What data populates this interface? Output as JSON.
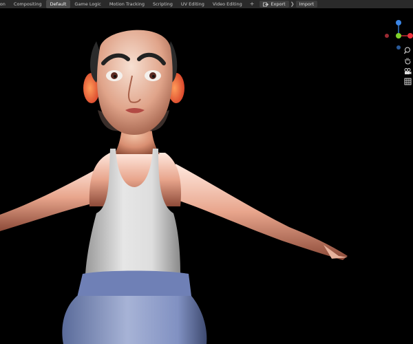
{
  "workspace_tabs": [
    {
      "label": "ion",
      "active": false
    },
    {
      "label": "Compositing",
      "active": false
    },
    {
      "label": "Default",
      "active": true
    },
    {
      "label": "Game Logic",
      "active": false
    },
    {
      "label": "Motion Tracking",
      "active": false
    },
    {
      "label": "Scripting",
      "active": false
    },
    {
      "label": "UV Editing",
      "active": false
    },
    {
      "label": "Video Editing",
      "active": false
    }
  ],
  "add_workspace_label": "+",
  "addons": {
    "export_label": "Export",
    "import_label": "Import",
    "export_icon": "export-icon"
  },
  "gizmo": {
    "x_color": "#e8333e",
    "y_color": "#7fd12a",
    "z_color": "#3b86e6",
    "neg_x_color": "#9b2a33",
    "neg_y_color": "#4d7a22",
    "neg_z_color": "#2a5a9a"
  },
  "nav_tools": [
    "zoom-icon",
    "hand-pan-icon",
    "camera-icon",
    "grid-icon"
  ],
  "viewport_background": "#000000"
}
